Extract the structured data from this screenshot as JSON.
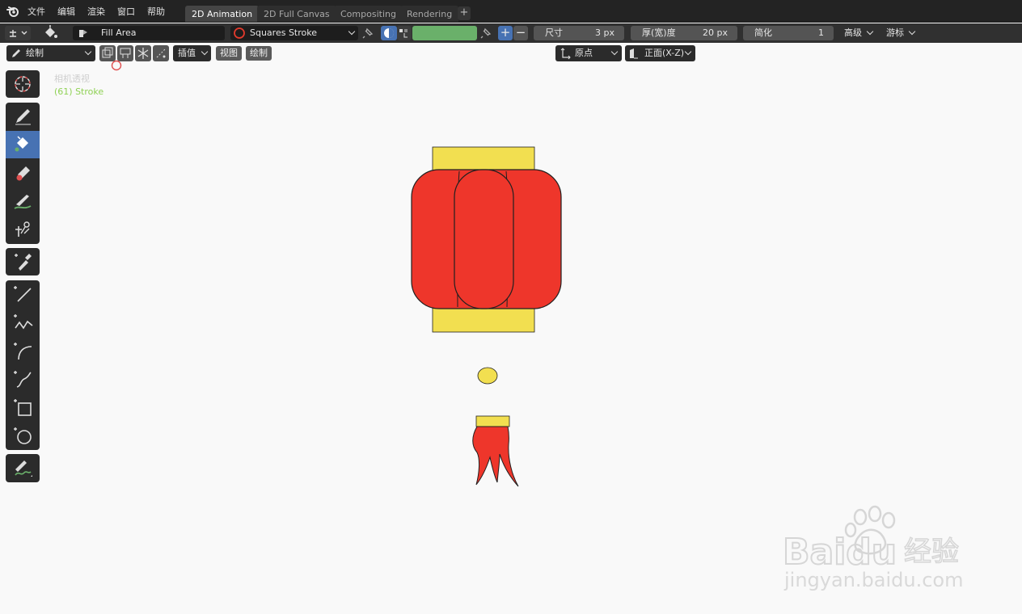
{
  "menu": {
    "items": [
      "文件",
      "编辑",
      "渲染",
      "窗口",
      "帮助"
    ]
  },
  "workspace_tabs": [
    {
      "label": "2D Animation",
      "active": true
    },
    {
      "label": "2D Full Canvas",
      "active": false
    },
    {
      "label": "Compositing",
      "active": false
    },
    {
      "label": "Rendering",
      "active": false
    }
  ],
  "tool_header": {
    "brush_name": "Fill Area",
    "material_name": "Squares Stroke",
    "vertex_color": "#6ab06a",
    "size_label": "尺寸",
    "size_value": "3 px",
    "thickness_label": "厚(宽)度",
    "thickness_value": "20 px",
    "simplify_label": "简化",
    "simplify_value": "1",
    "advanced_label": "高级",
    "cursor_label": "游标"
  },
  "viewport_header": {
    "mode": "绘制",
    "interpolate_label": "插值",
    "view_label": "视图",
    "draw_label": "绘制",
    "origin_label": "原点",
    "orientation_label": "正面(X-Z)"
  },
  "overlay": {
    "view_name": "相机透视",
    "object_info": "(61) Stroke"
  },
  "toolbar": {
    "tools": [
      {
        "name": "cursor",
        "icon": "cursor-icon",
        "active": false
      },
      {
        "name": "draw",
        "icon": "pencil-icon",
        "active": false
      },
      {
        "name": "fill",
        "icon": "fill-bucket-icon",
        "active": true
      },
      {
        "name": "erase",
        "icon": "eraser-icon",
        "active": false
      },
      {
        "name": "tint",
        "icon": "tint-brush-icon",
        "active": false
      },
      {
        "name": "cutter",
        "icon": "cutter-icon",
        "active": false
      },
      {
        "name": "eyedropper",
        "icon": "eyedropper-icon",
        "active": false
      },
      {
        "name": "line",
        "icon": "line-icon",
        "active": false
      },
      {
        "name": "polyline",
        "icon": "polyline-icon",
        "active": false
      },
      {
        "name": "arc",
        "icon": "arc-icon",
        "active": false
      },
      {
        "name": "curve",
        "icon": "curve-icon",
        "active": false
      },
      {
        "name": "box",
        "icon": "box-icon",
        "active": false
      },
      {
        "name": "circle",
        "icon": "circle-icon",
        "active": false
      },
      {
        "name": "annotate",
        "icon": "annotate-icon",
        "active": false
      }
    ]
  },
  "colors": {
    "lantern_red": "#ee362b",
    "lantern_gold": "#f2df50",
    "outline": "#202020",
    "active_tool": "#4772b3",
    "overlay_text": "#8fd154"
  },
  "watermark": {
    "brand": "Baidu",
    "cn": "经验",
    "url": "jingyan.baidu.com"
  }
}
